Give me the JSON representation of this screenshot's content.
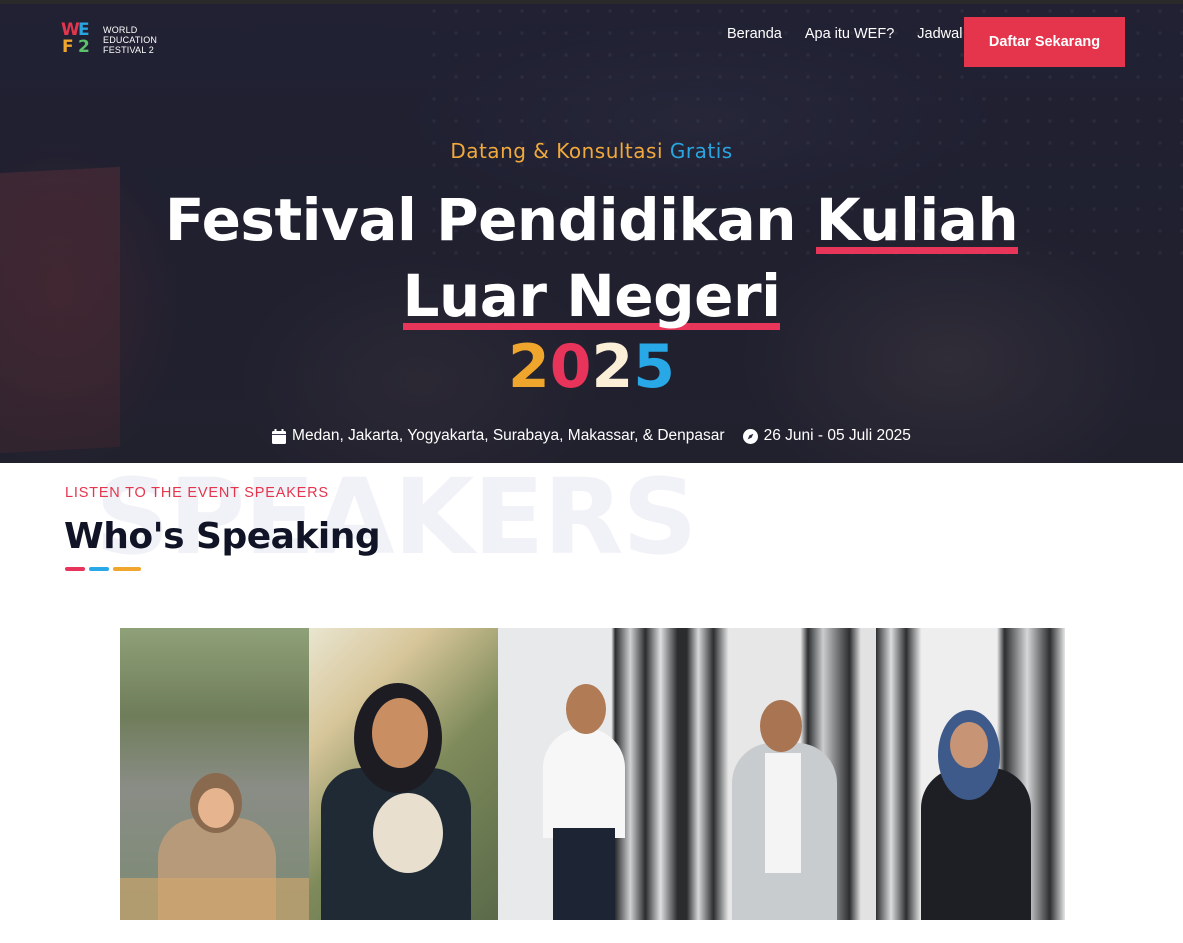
{
  "brand": {
    "logo_letters": [
      "W",
      "E",
      "F",
      "2"
    ],
    "logo_colors": [
      "#e5354d",
      "#2aa5e0",
      "#f0a52c",
      "#5cc26a"
    ],
    "name_lines": [
      "WORLD",
      "EDUCATION",
      "FESTIVAL 2"
    ]
  },
  "nav": {
    "items": [
      {
        "label": "Beranda"
      },
      {
        "label": "Apa itu WEF?"
      },
      {
        "label": "Jadwal"
      }
    ],
    "cta_label": "Daftar Sekarang",
    "cta_color": "#e5354d"
  },
  "hero": {
    "eyebrow_main": "Datang & Konsultasi",
    "eyebrow_highlight": "Gratis",
    "headline_part1": "Festival Pendidikan",
    "headline_underlined_1": "Kuliah",
    "headline_underlined_2": "Luar Negeri",
    "year_digits": [
      "2",
      "0",
      "2",
      "5"
    ],
    "cities": "Medan, Jakarta, Yogyakarta, Surabaya, Makassar, & Denpasar",
    "dates": "26 Juni - 05 Juli 2025",
    "cities_icon": "calendar-icon",
    "dates_icon": "compass-icon"
  },
  "speakers": {
    "watermark": "SPEAKERS",
    "kicker": "LISTEN TO THE EVENT SPEAKERS",
    "title": "Who's Speaking",
    "accent_colors": [
      "#e8335a",
      "#28a8e6",
      "#f0a52c"
    ],
    "photo_count": 5
  }
}
